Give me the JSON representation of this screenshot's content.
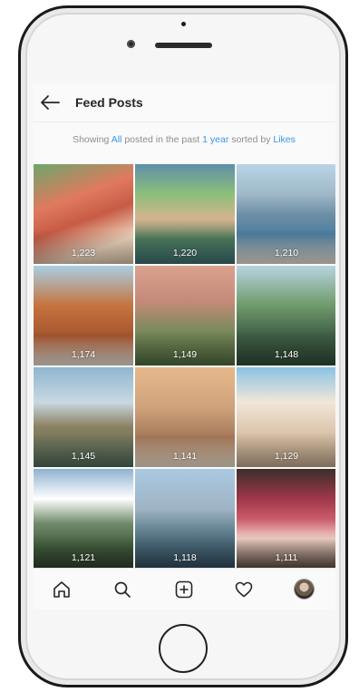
{
  "header": {
    "title": "Feed Posts",
    "back_icon": "arrow-left-icon"
  },
  "filter": {
    "prefix": "Showing",
    "scope": "All",
    "middle": "posted in the past",
    "range": "1 year",
    "sort_text": "sorted by",
    "sort": "Likes"
  },
  "posts": [
    {
      "likes": "1,223"
    },
    {
      "likes": "1,220"
    },
    {
      "likes": "1,210"
    },
    {
      "likes": "1,174"
    },
    {
      "likes": "1,149"
    },
    {
      "likes": "1,148"
    },
    {
      "likes": "1,145"
    },
    {
      "likes": "1,141"
    },
    {
      "likes": "1,129"
    },
    {
      "likes": "1,121"
    },
    {
      "likes": "1,118"
    },
    {
      "likes": "1,111"
    }
  ],
  "tabbar": {
    "items": [
      "home-icon",
      "search-icon",
      "add-post-icon",
      "heart-icon",
      "profile-avatar"
    ]
  },
  "colors": {
    "link": "#3897f0",
    "text": "#262626",
    "muted": "#8e8e8e"
  }
}
